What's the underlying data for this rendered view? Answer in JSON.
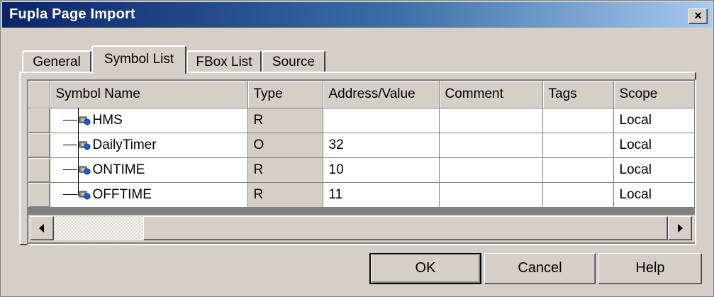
{
  "window": {
    "title": "Fupla Page Import",
    "close_label": "×"
  },
  "tabs": [
    {
      "label": "General",
      "active": false
    },
    {
      "label": "Symbol List",
      "active": true
    },
    {
      "label": "FBox List",
      "active": false
    },
    {
      "label": "Source",
      "active": false
    }
  ],
  "table": {
    "columns": [
      "Symbol Name",
      "Type",
      "Address/Value",
      "Comment",
      "Tags",
      "Scope"
    ],
    "rows": [
      {
        "name": "HMS",
        "type": "R",
        "address": "",
        "comment": "",
        "tags": "",
        "scope": "Local"
      },
      {
        "name": "DailyTimer",
        "type": "O",
        "address": "32",
        "comment": "",
        "tags": "",
        "scope": "Local"
      },
      {
        "name": "ONTIME",
        "type": "R",
        "address": "10",
        "comment": "",
        "tags": "",
        "scope": "Local"
      },
      {
        "name": "OFFTIME",
        "type": "R",
        "address": "11",
        "comment": "",
        "tags": "",
        "scope": "Local"
      }
    ],
    "row_icon": "symbol-icon"
  },
  "scrollbar": {
    "left_icon": "arrow-left-icon",
    "right_icon": "arrow-right-icon"
  },
  "buttons": {
    "ok": "OK",
    "cancel": "Cancel",
    "help": "Help"
  },
  "colors": {
    "title_start": "#0a246a",
    "title_end": "#a6caf0",
    "face": "#d4d0c8"
  }
}
